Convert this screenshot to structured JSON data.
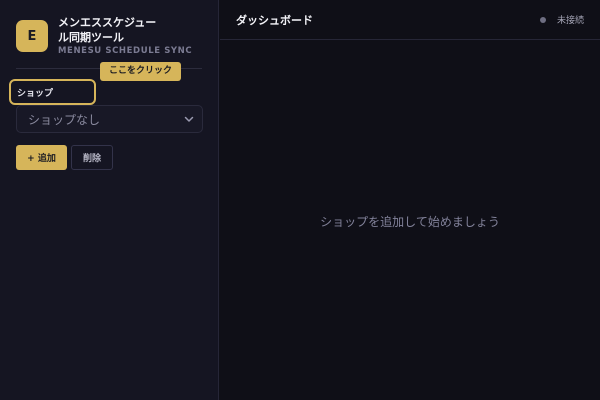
{
  "app": {
    "logo_letter": "E",
    "title": "メンエススケジュール同期ツール",
    "subtitle": "MENESU SCHEDULE SYNC"
  },
  "tooltip": "ここをクリック",
  "shop": {
    "label": "ショップ",
    "selected": "ショップなし"
  },
  "buttons": {
    "add": "+ 追加",
    "delete": "削除"
  },
  "header": {
    "title": "ダッシュボード",
    "status": "未接続"
  },
  "main": {
    "empty_message": "ショップを追加して始めましょう"
  },
  "colors": {
    "accent": "#d6b55a",
    "background": "#0f0f17",
    "sidebar": "#151522",
    "status_disconnected": "#6e6e82"
  },
  "icons": {
    "select_chevron": "chevron-down-icon",
    "status": "status-dot-icon"
  }
}
